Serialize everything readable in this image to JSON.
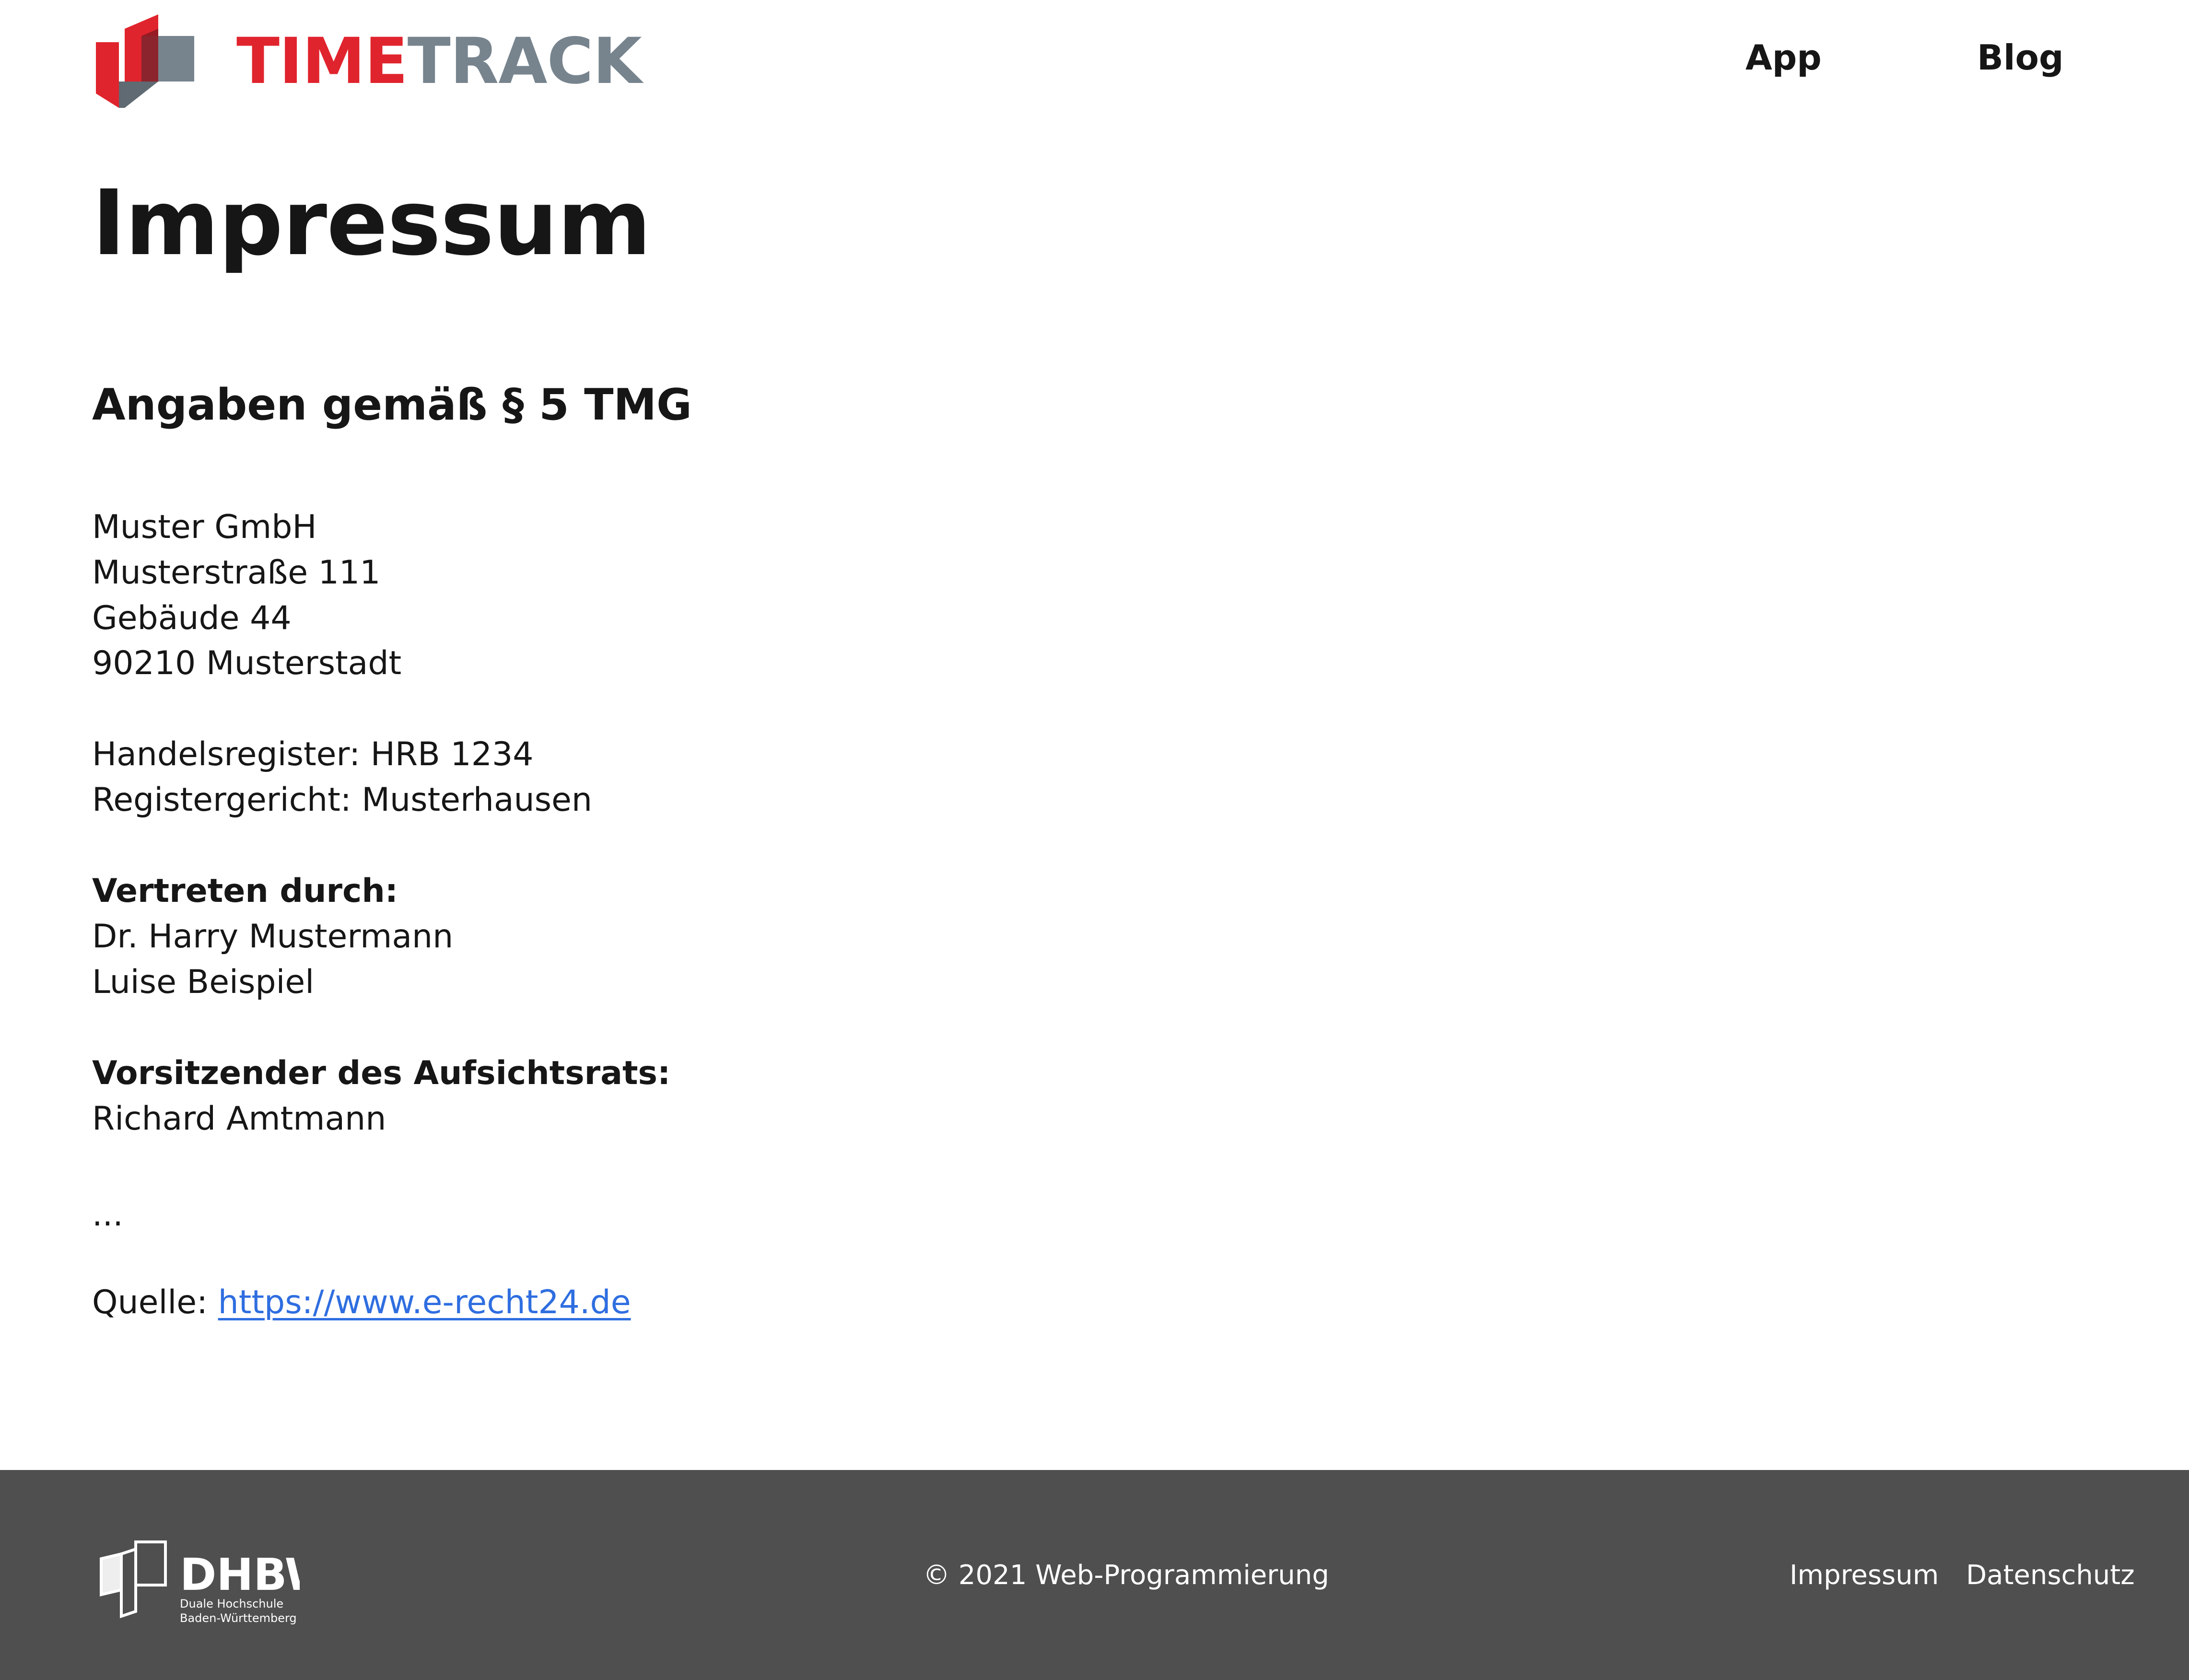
{
  "header": {
    "logo_word_time": "TIME",
    "logo_word_track": "TRACK",
    "nav": [
      {
        "label": "App"
      },
      {
        "label": "Blog"
      }
    ]
  },
  "main": {
    "title": "Impressum",
    "section_title": "Angaben gemäß § 5 TMG",
    "address": [
      "Muster GmbH",
      "Musterstraße 111",
      "Gebäude 44",
      "90210 Musterstadt"
    ],
    "register": [
      "Handelsregister: HRB 1234",
      "Registergericht: Musterhausen"
    ],
    "represented_heading": "Vertreten durch:",
    "represented_by": [
      "Dr. Harry Mustermann",
      "Luise Beispiel"
    ],
    "board_heading": "Vorsitzender des Aufsichtsrats:",
    "board_chair": "Richard Amtmann",
    "ellipsis": "...",
    "source_label": "Quelle:",
    "source_link": "https://www.e-recht24.de"
  },
  "footer": {
    "logo_word": "DHBW",
    "logo_line1": "Duale Hochschule",
    "logo_line2": "Baden-Württemberg",
    "copyright": "© 2021 Web-Programmierung",
    "links": [
      {
        "label": "Impressum"
      },
      {
        "label": "Datenschutz"
      }
    ]
  },
  "colors": {
    "brand_red": "#e0242d",
    "brand_grey": "#77848e",
    "link_blue": "#2f6ee0",
    "footer_bg": "#4f4f4f"
  }
}
